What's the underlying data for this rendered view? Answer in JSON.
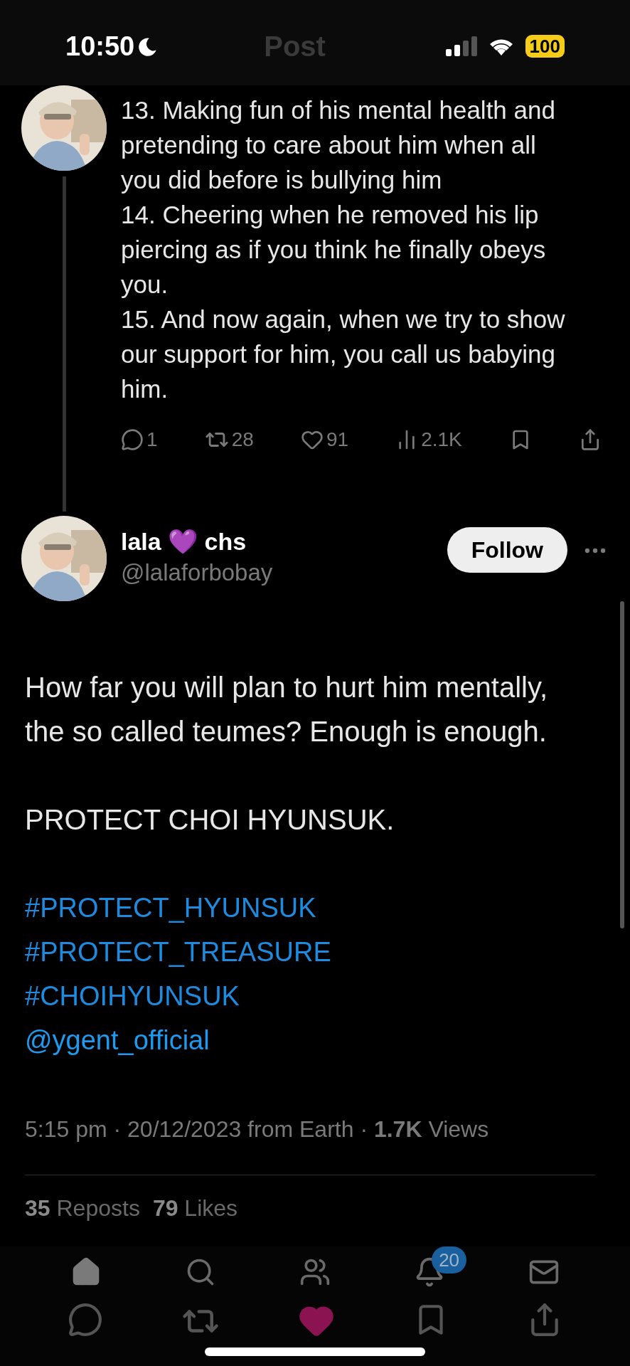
{
  "status_bar": {
    "time": "10:50",
    "focus_moon": true,
    "battery": "100"
  },
  "header": {
    "title": "Post"
  },
  "parent_tweet": {
    "items": [
      "13. Making fun of his mental health and pretending to care about him when all you did before is bullying him",
      "14. Cheering when he removed his lip piercing as if you think he finally obeys you.",
      "15. And now again, when we try to show our support for him, you call us babying him."
    ],
    "actions": {
      "replies": "1",
      "reposts": "28",
      "likes": "91",
      "views": "2.1K"
    }
  },
  "main_tweet": {
    "name": "lala 💜 chs",
    "handle": "@lalaforbobay",
    "follow": "Follow",
    "paragraphs": [
      "How far you will plan to hurt him mentally, the so called teumes? Enough is enough.",
      "PROTECT CHOI HYUNSUK."
    ],
    "links": [
      {
        "kind": "hashtag",
        "text": "#PROTECT_HYUNSUK"
      },
      {
        "kind": "hashtag",
        "text": "#PROTECT_TREASURE"
      },
      {
        "kind": "hashtag",
        "text": "#CHOIHYUNSUK"
      },
      {
        "kind": "mention",
        "text": "@ygent_official"
      }
    ],
    "meta": "5:15 pm · 20/12/2023 from Earth · **1.7K** Views",
    "stats": [
      {
        "count": "35",
        "label": "Reposts"
      },
      {
        "count": "79",
        "label": "Likes"
      }
    ]
  },
  "tab_bar": [
    {
      "kind": "home",
      "selected": true
    },
    {
      "kind": "search",
      "selected": false
    },
    {
      "kind": "communities",
      "selected": false
    },
    {
      "kind": "notifications",
      "selected": false,
      "badge": "20"
    },
    {
      "kind": "messages",
      "selected": false
    }
  ],
  "action_bar": {
    "liked": true
  }
}
